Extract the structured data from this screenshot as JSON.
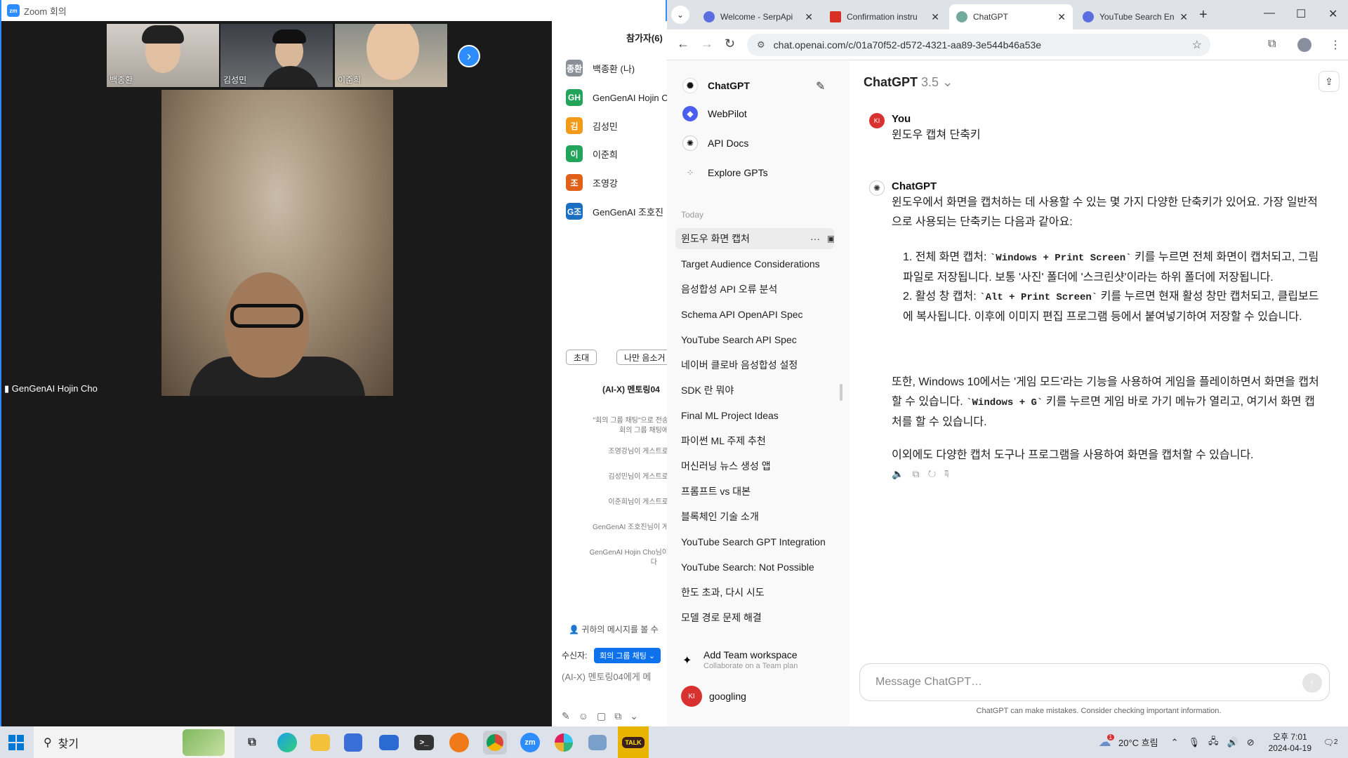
{
  "zoom": {
    "title": "Zoom 회의",
    "thumbnails": [
      "백종환",
      "김성민",
      "이준희"
    ],
    "main_speaker": "GenGenAI Hojin Cho",
    "panel": {
      "participants_title": "참가자(6)",
      "participants": [
        {
          "initial": "종환",
          "name": "백종환 (나)",
          "color": "#8a8f98"
        },
        {
          "initial": "GH",
          "name": "GenGenAI Hojin C",
          "color": "#22a55a"
        },
        {
          "initial": "김",
          "name": "김성민",
          "color": "#f29a1a"
        },
        {
          "initial": "이",
          "name": "이준희",
          "color": "#22a55a"
        },
        {
          "initial": "조",
          "name": "조영강",
          "color": "#e0601a"
        },
        {
          "initial": "G조",
          "name": "GenGenAI 조호진",
          "color": "#1a6fc4"
        }
      ],
      "invite_label": "초대",
      "mute_label": "나만 음소거",
      "chat_title": "(AI-X) 멘토링04",
      "chat_lines": [
        "\"회의 그룹 채팅\"으로 전송",
        "회의 그룹 채팅에",
        "조영강님이 게스트로",
        "김성민님이 게스트로",
        "이준희님이 게스트로",
        "GenGenAI 조호진님이 게",
        "GenGenAI Hojin Cho님이",
        "다"
      ],
      "hint": "귀하의 메시지를 볼 수",
      "recv_label": "수신자:",
      "recv_value": "회의 그룹 채팅",
      "input_placeholder": "(AI-X) 멘토링04에게 메"
    }
  },
  "chrome": {
    "tabs": [
      {
        "title": "Welcome - SerpApi",
        "color": "#5b6ee1"
      },
      {
        "title": "Confirmation instru",
        "color": "#d93025"
      },
      {
        "title": "ChatGPT",
        "color": "#74aa9c"
      },
      {
        "title": "YouTube Search En",
        "color": "#5b6ee1"
      }
    ],
    "url": "chat.openai.com/c/01a70f52-d572-4321-aa89-3e544b46a53e"
  },
  "gpt": {
    "sidebar": {
      "top": [
        {
          "label": "ChatGPT",
          "icon": "chatgpt-icon"
        },
        {
          "label": "WebPilot",
          "icon": "webpilot-icon"
        },
        {
          "label": "API Docs",
          "icon": "api-docs-icon"
        },
        {
          "label": "Explore GPTs",
          "icon": "explore-grid-icon"
        }
      ],
      "section": "Today",
      "history": [
        "윈도우 화면 캡처",
        "Target Audience Considerations",
        "음성합성 API 오류 분석",
        "Schema API OpenAPI Spec",
        "YouTube Search API Spec",
        "네이버 클로바 음성합성 설정",
        "SDK 란 뭐야",
        "Final ML Project Ideas",
        "파이썬 ML 주제 추천",
        "머신러닝 뉴스 생성 앱",
        "프롬프트 vs 대본",
        "블록체인 기술 소개",
        "YouTube Search GPT Integration",
        "YouTube Search: Not Possible",
        "한도 초과, 다시 시도",
        "모델 경로 문제 해결"
      ],
      "add_team_title": "Add Team workspace",
      "add_team_sub": "Collaborate on a Team plan",
      "user_initials": "KI",
      "user_name": "googling"
    },
    "model": "ChatGPT",
    "model_version": "3.5",
    "user_name": "You",
    "user_initials": "KI",
    "user_message": "윈도우 캡쳐 단축키",
    "assistant_name": "ChatGPT",
    "answer": {
      "intro": "윈도우에서 화면을 캡처하는 데 사용할 수 있는 몇 가지 다양한 단축키가 있어요. 가장 일반적으로 사용되는 단축키는 다음과 같아요:",
      "item1_prefix": "1. 전체 화면 캡처: ",
      "item1_key": "`Windows + Print Screen`",
      "item1_suffix": " 키를 누르면 전체 화면이 캡처되고, 그림 파일로 저장됩니다. 보통 '사진' 폴더에 '스크린샷'이라는 하위 폴더에 저장됩니다.",
      "item2_prefix": "2. 활성 창 캡처: ",
      "item2_key": "`Alt + Print Screen`",
      "item2_suffix": " 키를 누르면 현재 활성 창만 캡처되고, 클립보드에 복사됩니다. 이후에 이미지 편집 프로그램 등에서 붙여넣기하여 저장할 수 있습니다.",
      "para2_prefix": "또한, Windows 10에서는 '게임 모드'라는 기능을 사용하여 게임을 플레이하면서 화면을 캡처할 수 있습니다. ",
      "para2_key": "`Windows + G`",
      "para2_suffix": " 키를 누르면 게임 바로 가기 메뉴가 열리고, 여기서 화면 캡처를 할 수 있습니다.",
      "para3": "이외에도 다양한 캡처 도구나 프로그램을 사용하여 화면을 캡처할 수 있습니다."
    },
    "input_placeholder": "Message ChatGPT…",
    "disclaimer": "ChatGPT can make mistakes. Consider checking important information."
  },
  "taskbar": {
    "search_label": "찾기",
    "weather": "20°C  흐림",
    "time": "오후 7:01",
    "date": "2024-04-19",
    "notifications": "2",
    "weather_badge": "1",
    "kakao_label": "TALK"
  }
}
